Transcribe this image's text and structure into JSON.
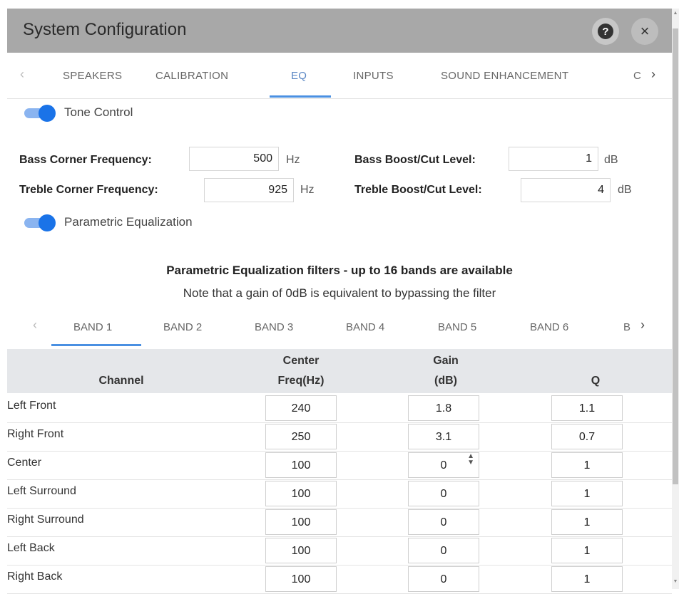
{
  "window": {
    "title": "System Configuration",
    "help_icon": "help-icon",
    "close_icon": "close-icon",
    "close_glyph": "×",
    "help_glyph": "?"
  },
  "tabs": [
    {
      "label": "SPEAKERS",
      "active": false
    },
    {
      "label": "CALIBRATION",
      "active": false
    },
    {
      "label": "EQ",
      "active": true
    },
    {
      "label": "INPUTS",
      "active": false
    },
    {
      "label": "SOUND ENHANCEMENT",
      "active": false
    },
    {
      "label": "C",
      "active": false
    }
  ],
  "tone_control": {
    "label": "Tone Control",
    "enabled": true,
    "bass_corner_label": "Bass Corner Frequency:",
    "bass_corner_value": "500",
    "bass_corner_unit": "Hz",
    "treble_corner_label": "Treble Corner Frequency:",
    "treble_corner_value": "925",
    "treble_corner_unit": "Hz",
    "bass_level_label": "Bass Boost/Cut Level:",
    "bass_level_value": "1",
    "bass_level_unit": "dB",
    "treble_level_label": "Treble Boost/Cut Level:",
    "treble_level_value": "4",
    "treble_level_unit": "dB"
  },
  "parametric": {
    "label": "Parametric Equalization",
    "enabled": true,
    "heading": "Parametric Equalization filters - up to 16 bands are available",
    "note": "Note that a gain of 0dB is equivalent to bypassing the filter"
  },
  "bands": [
    "BAND 1",
    "BAND 2",
    "BAND 3",
    "BAND 4",
    "BAND 5",
    "BAND 6",
    "B"
  ],
  "table": {
    "headers": {
      "channel": "Channel",
      "freq_line1": "Center",
      "freq_line2": "Freq(Hz)",
      "gain_line1": "Gain",
      "gain_line2": "(dB)",
      "q": "Q"
    },
    "rows": [
      {
        "channel": "Left Front",
        "freq": "240",
        "gain": "1.8",
        "q": "1.1"
      },
      {
        "channel": "Right Front",
        "freq": "250",
        "gain": "3.1",
        "q": "0.7"
      },
      {
        "channel": "Center",
        "freq": "100",
        "gain": "0",
        "q": "1"
      },
      {
        "channel": "Left Surround",
        "freq": "100",
        "gain": "0",
        "q": "1"
      },
      {
        "channel": "Right Surround",
        "freq": "100",
        "gain": "0",
        "q": "1"
      },
      {
        "channel": "Left Back",
        "freq": "100",
        "gain": "0",
        "q": "1"
      },
      {
        "channel": "Right Back",
        "freq": "100",
        "gain": "0",
        "q": "1"
      }
    ]
  },
  "colors": {
    "accent": "#4a90e2",
    "toggle_on": "#1a73e8",
    "titlebar": "#a8a8a8",
    "table_header": "#e5e7ea"
  }
}
